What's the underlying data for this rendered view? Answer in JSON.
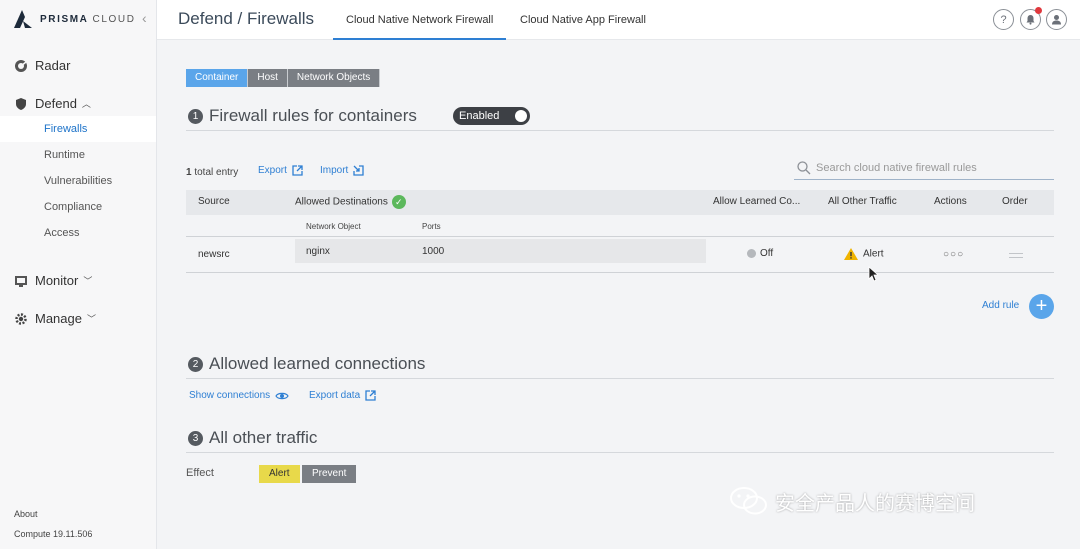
{
  "brand": {
    "name": "PRISMA",
    "suffix": "CLOUD"
  },
  "sidebar": {
    "radar": "Radar",
    "defend": "Defend",
    "defend_items": [
      "Firewalls",
      "Runtime",
      "Vulnerabilities",
      "Compliance",
      "Access"
    ],
    "monitor": "Monitor",
    "manage": "Manage",
    "about": "About",
    "version": "Compute 19.11.506"
  },
  "header": {
    "title": "Defend / Firewalls",
    "tabs": [
      "Cloud Native Network Firewall",
      "Cloud Native App Firewall"
    ],
    "help": "?"
  },
  "scope_tabs": [
    "Container",
    "Host",
    "Network Objects"
  ],
  "section1": {
    "num": "1",
    "title": "Firewall rules for containers",
    "toggle": "Enabled",
    "count_num": "1",
    "count_label": "total entry",
    "export": "Export",
    "import": "Import",
    "search_placeholder": "Search cloud native firewall rules",
    "columns": {
      "source": "Source",
      "allowed": "Allowed Destinations",
      "learned": "Allow Learned Co...",
      "other": "All Other Traffic",
      "actions": "Actions",
      "order": "Order"
    },
    "subcolumns": {
      "network_object": "Network Object",
      "ports": "Ports"
    },
    "rows": [
      {
        "source": "newsrc",
        "network_object": "nginx",
        "ports": "1000",
        "learned": "Off",
        "other": "Alert"
      }
    ],
    "add_rule": "Add rule",
    "add_symbol": "+"
  },
  "section2": {
    "num": "2",
    "title": "Allowed learned connections",
    "show": "Show connections",
    "export": "Export data"
  },
  "section3": {
    "num": "3",
    "title": "All other traffic",
    "effect_label": "Effect",
    "options": [
      "Alert",
      "Prevent"
    ]
  },
  "watermark": "安全产品人的赛博空间",
  "colors": {
    "accent": "#2e7fd3",
    "active_tab": "#5aa5ea",
    "alert": "#e8d94a",
    "prevent": "#7a7e84",
    "toggle": "#3d4045"
  }
}
